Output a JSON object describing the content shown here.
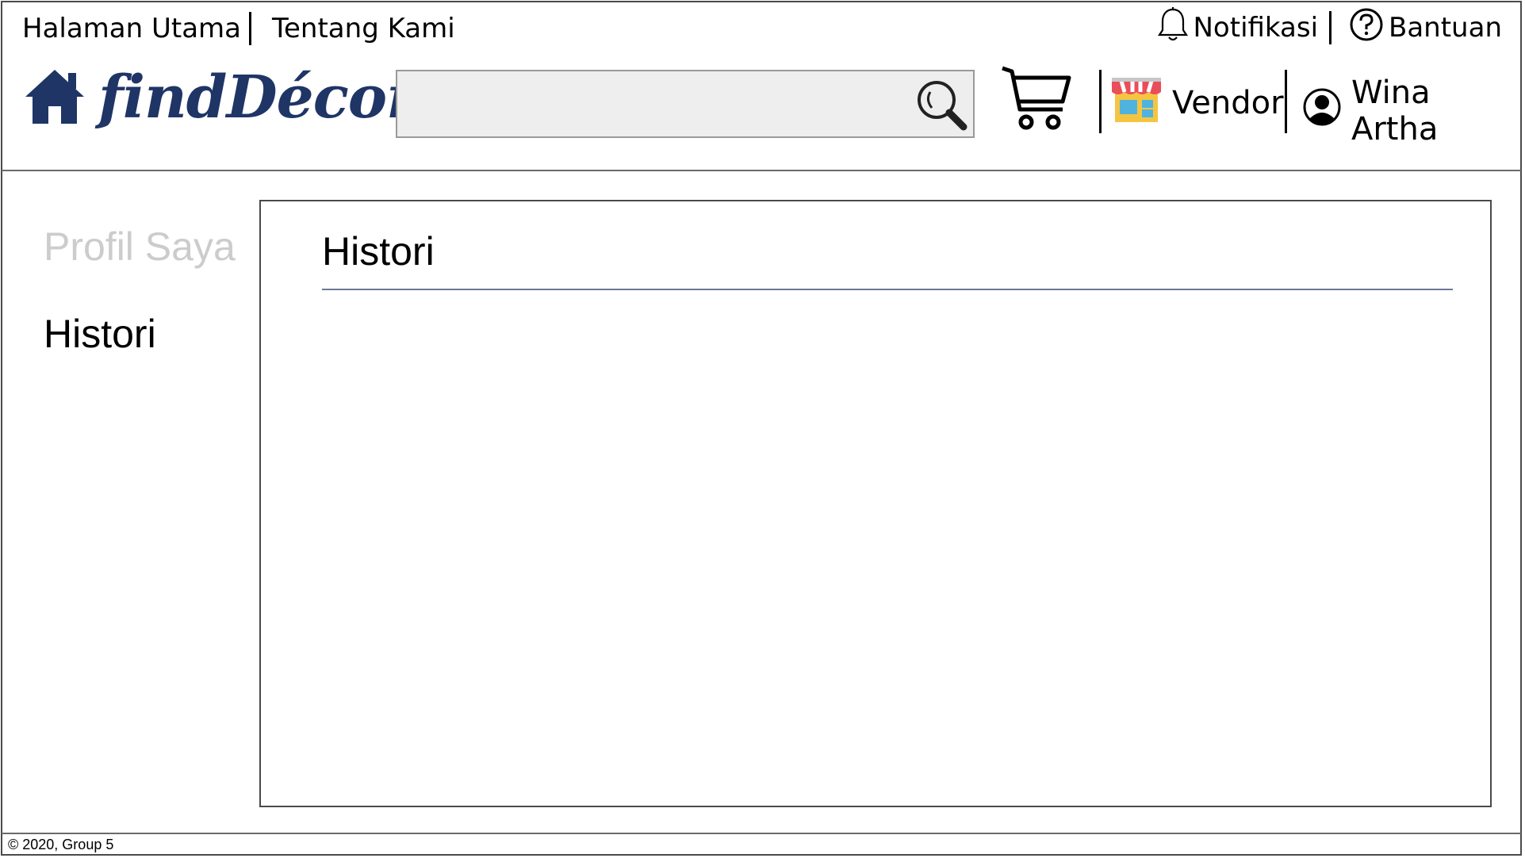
{
  "header": {
    "top_links": [
      "Halaman Utama",
      "Tentang Kami"
    ],
    "notification_label": "Notifikasi",
    "help_label": "Bantuan",
    "brand": "findDécor",
    "search_placeholder": "",
    "vendor_label": "Vendor",
    "user_name": "Wina Artha"
  },
  "sidebar": {
    "items": [
      {
        "label": "Profil Saya",
        "active": false
      },
      {
        "label": "Histori",
        "active": true
      }
    ]
  },
  "main": {
    "title": "Histori"
  },
  "footer": {
    "text": "© 2020, Group 5"
  },
  "colors": {
    "brand": "#1f3566",
    "inactive_text": "#cccccc",
    "rule": "#6b7a99",
    "search_bg": "#eeeeee"
  },
  "icons": {
    "home": "home-icon",
    "bell": "bell-icon",
    "help": "question-icon",
    "search": "search-icon",
    "cart": "cart-icon",
    "store": "store-icon",
    "user": "user-circle-icon"
  }
}
